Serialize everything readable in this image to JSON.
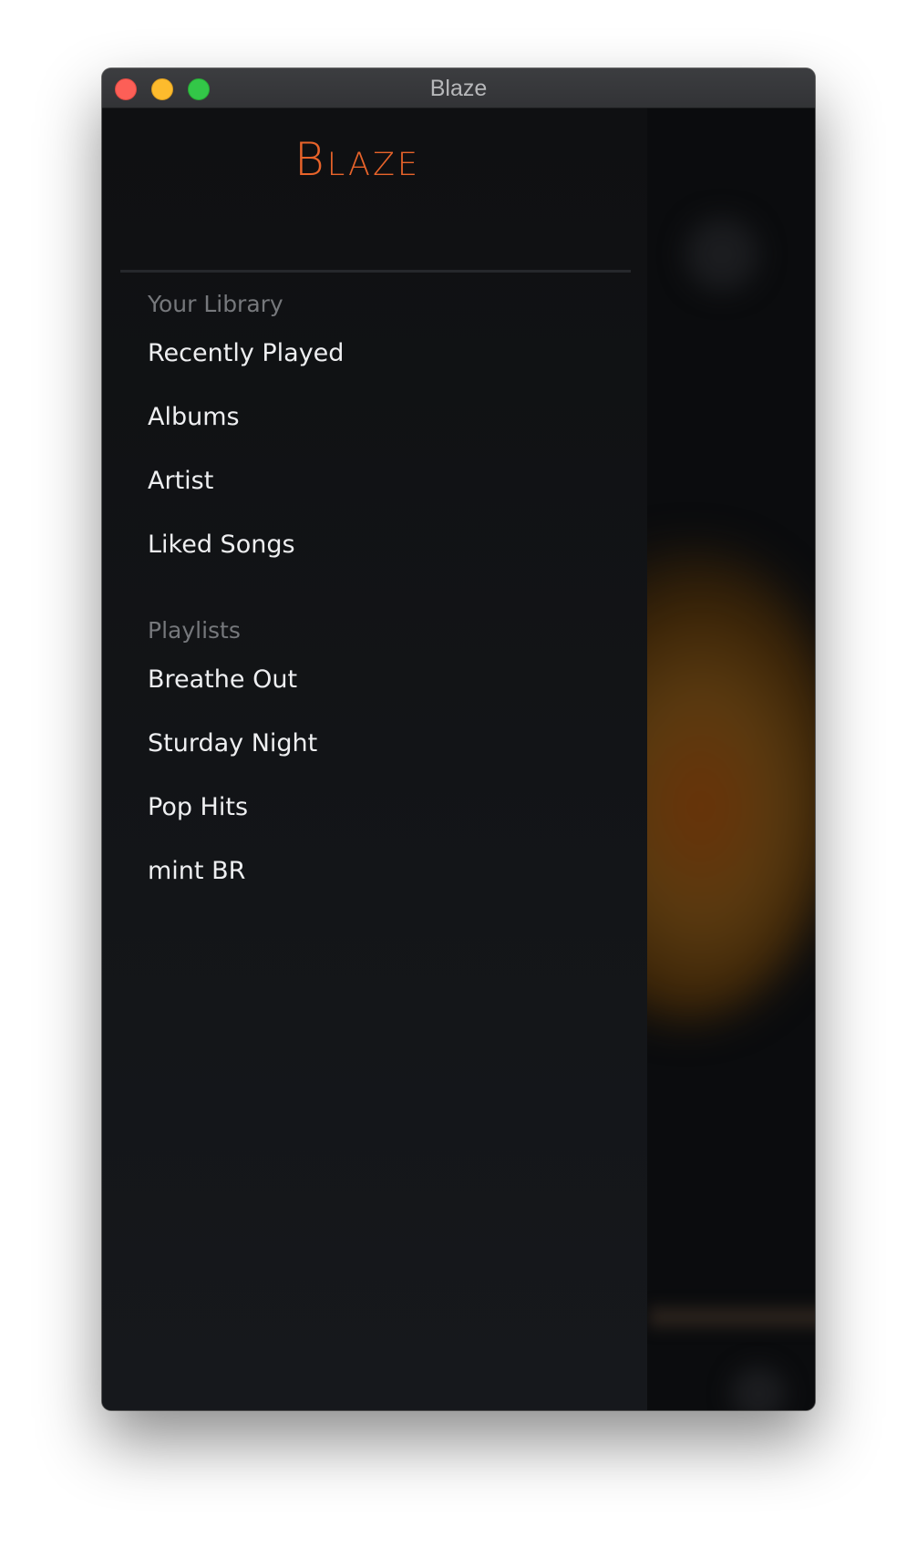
{
  "window": {
    "title": "Blaze"
  },
  "drawer": {
    "brand": "Blaze",
    "library": {
      "heading": "Your Library",
      "items": [
        "Recently Played",
        "Albums",
        "Artist",
        "Liked Songs"
      ]
    },
    "playlists": {
      "heading": "Playlists",
      "items": [
        "Breathe Out",
        "Sturday Night",
        "Pop Hits",
        "mint BR"
      ]
    }
  },
  "colors": {
    "accent": "#e8632a",
    "drawer_bg": "#121417",
    "text": "#eeeff1",
    "muted": "#76787c"
  }
}
